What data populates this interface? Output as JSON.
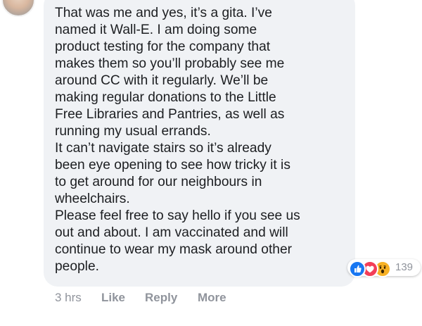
{
  "comment": {
    "lines": [
      "That was me and yes, it’s a gita. I’ve",
      "named it Wall-E. I am doing some",
      "product testing for the company that",
      "makes them so you’ll probably see me",
      "around CC with it regularly. We’ll be",
      "making regular donations to the Little",
      "Free Libraries and Pantries, as well as",
      "running my usual errands.",
      "It can’t navigate stairs so it’s already",
      "been eye opening to see how tricky it is",
      "to get around for our neighbours in",
      "wheelchairs.",
      "Please feel free to say hello if you see us",
      "out and about. I am vaccinated and will",
      "continue to wear my mask around other",
      "people."
    ]
  },
  "reactions": {
    "icons": [
      "like-icon",
      "love-icon",
      "wow-icon"
    ],
    "count": "139",
    "colors": {
      "like": "#1877f2",
      "love": "#f33e58",
      "wow": "#f7b125"
    }
  },
  "actions": {
    "time": "3 hrs",
    "like": "Like",
    "reply": "Reply",
    "more": "More"
  },
  "colors": {
    "bubble": "#f0f2f5",
    "text": "#1c1e21",
    "meta": "#90949c"
  }
}
